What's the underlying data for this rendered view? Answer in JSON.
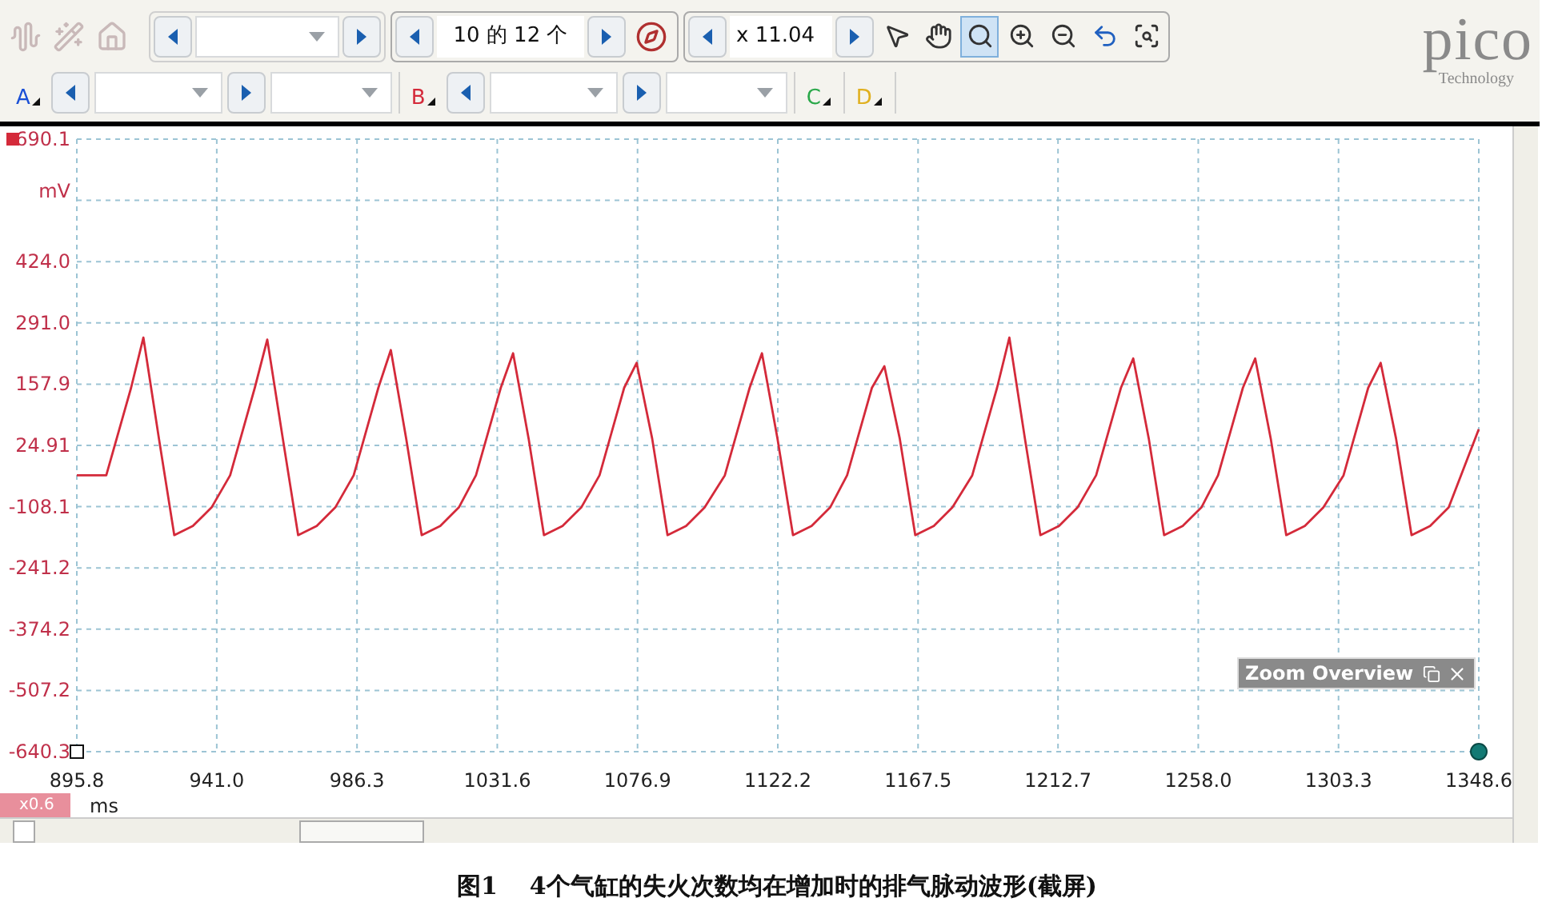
{
  "toolbar": {
    "left_tools": [
      {
        "kind": "waveform",
        "disabled": true
      },
      {
        "kind": "wand",
        "disabled": true
      },
      {
        "kind": "home",
        "disabled": true
      }
    ],
    "capture": {
      "text": "10 的 12 个"
    },
    "zoom": {
      "text": "x 11.04"
    },
    "tools": [
      {
        "kind": "pointer",
        "selected": false
      },
      {
        "kind": "hand",
        "selected": false
      },
      {
        "kind": "zoom",
        "selected": true
      },
      {
        "kind": "zoom-in",
        "selected": false
      },
      {
        "kind": "zoom-out",
        "selected": false
      },
      {
        "kind": "undo",
        "selected": false
      },
      {
        "kind": "overview",
        "selected": false
      }
    ]
  },
  "channels": [
    {
      "label": "A",
      "color": "#1a4fd6",
      "kind": "full"
    },
    {
      "label": "B",
      "color": "#d42a3a",
      "kind": "full"
    },
    {
      "label": "C",
      "color": "#2aa84a",
      "kind": "compact"
    },
    {
      "label": "D",
      "color": "#e0b020",
      "kind": "compact"
    }
  ],
  "logo": {
    "name": "pico",
    "tagline": "Technology"
  },
  "scope": {
    "x_unit": "ms",
    "zoom_badge": "x0.6",
    "overview_panel": {
      "title": "Zoom Overview"
    },
    "chart_data": {
      "type": "line",
      "grid": true,
      "ylabel": "mV",
      "xlim": [
        895.8,
        1348.6
      ],
      "ylim": [
        -640.3,
        690.1
      ],
      "xticks": [
        895.8,
        {
          "value": 941,
          "label": "941.0"
        },
        986.3,
        1031.6,
        1076.9,
        1122.2,
        1167.5,
        1212.7,
        {
          "value": 1258,
          "label": "1258.0"
        },
        1303.3,
        1348.6
      ],
      "yticks": [
        690.1,
        {
          "value": 424,
          "label": "424.0"
        },
        {
          "value": 291,
          "label": "291.0"
        },
        157.9,
        24.91,
        -108.1,
        -241.2,
        -374.2,
        -507.2,
        -640.3
      ],
      "x": [
        895.8,
        905.3,
        913.3,
        917.3,
        922.3,
        927.3,
        933.3,
        939.3,
        945.3,
        953.3,
        957.3,
        962.3,
        967.3,
        973.3,
        979.3,
        985.2,
        993.2,
        997.2,
        1002.2,
        1007.2,
        1013.2,
        1019.2,
        1024.7,
        1032.7,
        1036.7,
        1041.7,
        1046.7,
        1052.7,
        1058.7,
        1064.6,
        1072.6,
        1076.6,
        1081.6,
        1086.6,
        1092.6,
        1098.6,
        1105.1,
        1113.1,
        1117.1,
        1122.1,
        1127.1,
        1133.1,
        1139.1,
        1144.6,
        1152.6,
        1156.6,
        1161.6,
        1166.6,
        1172.6,
        1178.6,
        1185.0,
        1193.0,
        1197.0,
        1202.0,
        1207.0,
        1213.0,
        1219.0,
        1225.0,
        1233.0,
        1237.0,
        1242.0,
        1247.0,
        1253.0,
        1259.0,
        1264.4,
        1272.4,
        1276.4,
        1281.4,
        1286.4,
        1292.4,
        1298.4,
        1304.9,
        1312.9,
        1316.9,
        1321.9,
        1326.9,
        1332.9,
        1338.9,
        1348.6
      ],
      "series": [
        {
          "color": "#d42a3a",
          "values": [
            -40,
            -40,
            150,
            259,
            40,
            -170,
            -150,
            -110,
            -40,
            150,
            255,
            40,
            -170,
            -150,
            -110,
            -40,
            150,
            232,
            40,
            -170,
            -150,
            -110,
            -40,
            150,
            225,
            40,
            -170,
            -150,
            -110,
            -40,
            150,
            204,
            40,
            -170,
            -150,
            -110,
            -40,
            150,
            225,
            40,
            -170,
            -150,
            -110,
            -40,
            150,
            197,
            40,
            -170,
            -150,
            -110,
            -40,
            150,
            259,
            40,
            -170,
            -150,
            -110,
            -40,
            150,
            214,
            40,
            -170,
            -150,
            -110,
            -40,
            150,
            214,
            40,
            -170,
            -150,
            -110,
            -40,
            150,
            204,
            40,
            -170,
            -150,
            -110,
            60
          ]
        }
      ]
    }
  },
  "caption": {
    "label": "图1",
    "text": "4个气缸的失火次数均在增加时的排气脉动波形(截屏)"
  }
}
